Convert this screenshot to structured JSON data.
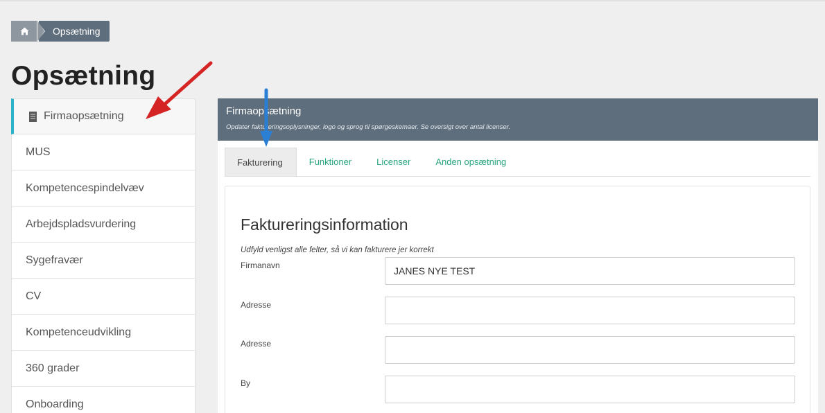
{
  "colors": {
    "header_bg": "#5f6e7d",
    "active_accent": "#2bb3c9",
    "tab_link": "#2aa47f",
    "arrow_red": "#d42424",
    "arrow_blue": "#2a7fd4"
  },
  "breadcrumb": {
    "home_icon": "home-icon",
    "current": "Opsætning"
  },
  "page_title": "Opsætning",
  "sidebar": {
    "items": [
      {
        "label": "Firmaopsætning",
        "icon": "building-icon",
        "active": true
      },
      {
        "label": "MUS"
      },
      {
        "label": "Kompetencespindelvæv"
      },
      {
        "label": "Arbejdspladsvurdering"
      },
      {
        "label": "Sygefravær"
      },
      {
        "label": "CV"
      },
      {
        "label": "Kompetenceudvikling"
      },
      {
        "label": "360 grader"
      },
      {
        "label": "Onboarding"
      }
    ]
  },
  "panel": {
    "title": "Firmaopsætning",
    "subtitle": "Opdater faktureringsoplysninger, logo og sprog til spørgeskemaer. Se oversigt over antal licenser.",
    "tabs": [
      {
        "label": "Fakturering",
        "active": true
      },
      {
        "label": "Funktioner"
      },
      {
        "label": "Licenser"
      },
      {
        "label": "Anden opsætning"
      }
    ]
  },
  "form": {
    "title": "Faktureringsinformation",
    "subtitle": "Udfyld venligst alle felter, så vi kan fakturere jer korrekt",
    "fields": [
      {
        "label": "Firmanavn",
        "value": "JANES NYE TEST"
      },
      {
        "label": "Adresse",
        "value": ""
      },
      {
        "label": "Adresse",
        "value": ""
      },
      {
        "label": "By",
        "value": ""
      }
    ]
  }
}
